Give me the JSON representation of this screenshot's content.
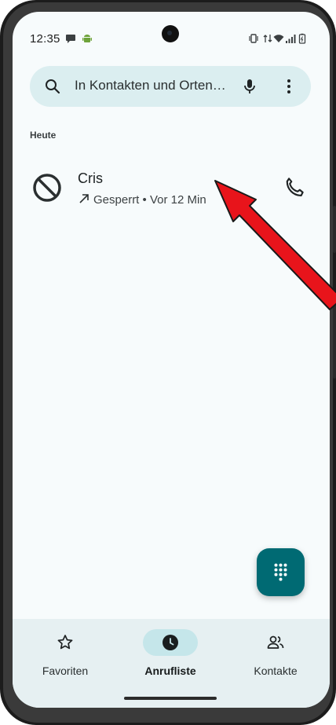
{
  "status_bar": {
    "time": "12:35",
    "left_icons": [
      "chat-bubble-icon",
      "android-icon"
    ],
    "right_icons": [
      "vibrate-icon",
      "data-arrows-icon",
      "wifi-icon",
      "signal-icon",
      "battery-icon"
    ]
  },
  "search": {
    "placeholder": "In Kontakten und Orten…",
    "left_icon": "search-icon",
    "right_icons": [
      "mic-icon",
      "more-vert-icon"
    ]
  },
  "section": {
    "label": "Heute"
  },
  "call_log": [
    {
      "icon": "blocked-icon",
      "name": "Cris",
      "direction_icon": "outgoing-arrow-icon",
      "status": "Gesperrt",
      "separator": "•",
      "time": "Vor 12 Min",
      "action_icon": "phone-icon"
    }
  ],
  "fab": {
    "icon": "dialpad-icon"
  },
  "bottom_nav": {
    "items": [
      {
        "label": "Favoriten",
        "icon": "star-icon",
        "active": false
      },
      {
        "label": "Anrufliste",
        "icon": "clock-icon",
        "active": true
      },
      {
        "label": "Kontakte",
        "icon": "people-icon",
        "active": false
      }
    ]
  },
  "colors": {
    "screen_bg": "#f7fbfc",
    "search_bg": "#dbeef0",
    "fab_bg": "#006a73",
    "nav_bg": "#e6f0f2",
    "nav_active_pill": "#c5e6ea",
    "annotation_arrow": "#e8141b"
  }
}
